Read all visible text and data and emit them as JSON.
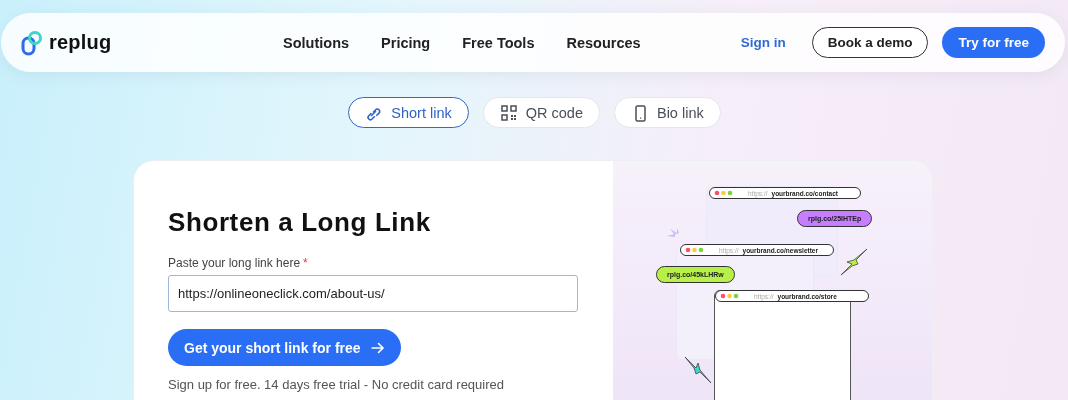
{
  "header": {
    "logo_text": "replug",
    "nav": [
      "Solutions",
      "Pricing",
      "Free Tools",
      "Resources"
    ],
    "sign_in": "Sign in",
    "book_demo": "Book a demo",
    "try_free": "Try for free"
  },
  "tabs": [
    {
      "label": "Short link",
      "kind": "link",
      "selected": true
    },
    {
      "label": "QR code",
      "kind": "qr",
      "selected": false
    },
    {
      "label": "Bio link",
      "kind": "phone",
      "selected": false
    }
  ],
  "card": {
    "title": "Shorten a Long Link",
    "field": {
      "label": "Paste your long link here",
      "required": true,
      "required_mark": "*",
      "value": "https://onlineoneclick.com/about-us/"
    },
    "submit": "Get your short link for free",
    "note": "Sign up for free. 14 days free trial - No credit card required"
  },
  "illustration": {
    "browsers": [
      {
        "scheme": "https://",
        "address": "yourbrand.co/contact"
      },
      {
        "scheme": "https://",
        "address": "yourbrand.co/newsletter"
      },
      {
        "scheme": "https://",
        "address": "yourbrand.co/store"
      }
    ],
    "short_links": [
      {
        "text": "rplg.co/25lHTEp",
        "color": "#c77dff"
      },
      {
        "text": "rplg.co/45kLHRw",
        "color": "#b8f04a"
      }
    ]
  }
}
